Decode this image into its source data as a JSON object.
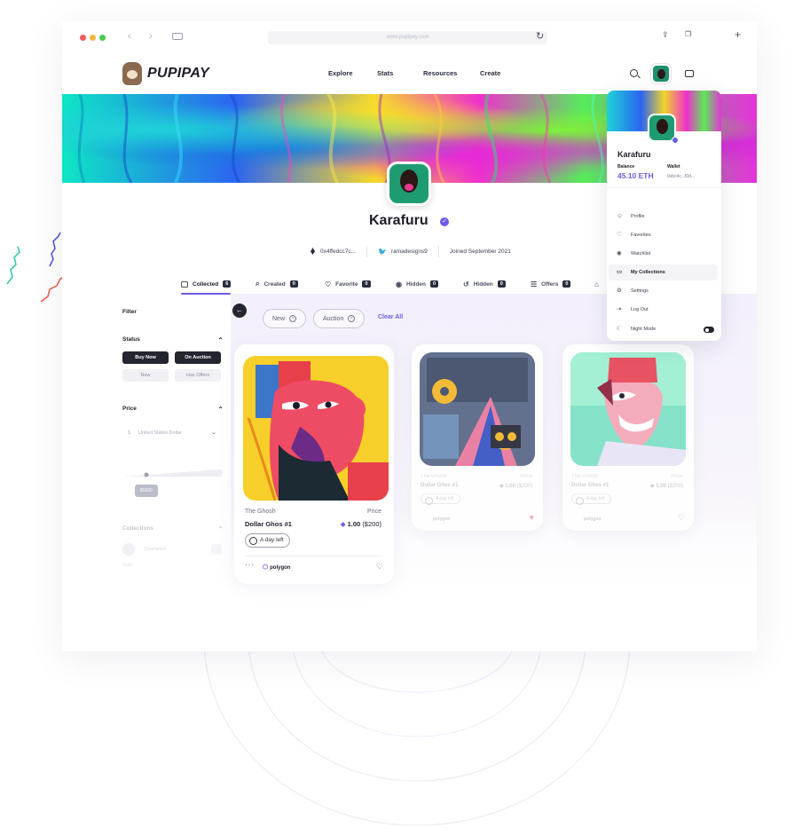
{
  "browser": {
    "url": "www.pupipay.com"
  },
  "site": {
    "brand": "PUPIPAY",
    "nav": [
      "Explore",
      "Stats",
      "Resources",
      "Create"
    ]
  },
  "profile": {
    "name": "Karafuru",
    "address": "0x4ffedcc7c...",
    "twitter": "ramadesigns9",
    "joined": "Joined September 2021"
  },
  "tabs": [
    {
      "label": "Collected",
      "count": "6"
    },
    {
      "label": "Created",
      "count": "0"
    },
    {
      "label": "Favorite",
      "count": "0"
    },
    {
      "label": "Hidden",
      "count": "0"
    },
    {
      "label": "Hidden",
      "count": "0"
    },
    {
      "label": "Offers",
      "count": "0"
    }
  ],
  "filter": {
    "title": "Filter",
    "status": {
      "title": "Status",
      "options": [
        "Buy Now",
        "On Auction",
        "New",
        "Has Offers"
      ]
    },
    "price": {
      "title": "Price",
      "currency": "United States Dollar",
      "badge": "$5000"
    },
    "collections": {
      "title": "Collections",
      "item": "Chameleo",
      "sub": "2066"
    }
  },
  "chips": {
    "items": [
      "New",
      "Auction"
    ],
    "clear_all": "Clear All"
  },
  "cards": [
    {
      "collection": "The Ghosh",
      "price_label": "Price",
      "name": "Dollar Ghos #1",
      "price_eth": "1.00",
      "price_usd": "($200)",
      "time_left": "A day left",
      "chain": "polygon"
    },
    {
      "collection": "The Ghosh",
      "price_label": "Price",
      "name": "Dollar Ghos #1",
      "price_eth": "1.00",
      "price_usd": "($200)",
      "time_left": "A day left",
      "chain": "polygon"
    },
    {
      "collection": "The Ghosh",
      "price_label": "Price",
      "name": "Dollar Ghos #1",
      "price_eth": "1.00",
      "price_usd": "($200)",
      "time_left": "A day left",
      "chain": "polygon"
    }
  ],
  "dropdown": {
    "name": "Karafuru",
    "balance_label": "Balance",
    "balance": "45.10 ETH",
    "wallet_label": "Wallet",
    "wallet": "0xbc4c...f0d...",
    "items": [
      "Profile",
      "Favorites",
      "Watchlist",
      "My Collections",
      "Settings",
      "Log Out",
      "Night Mode"
    ]
  },
  "colors": {
    "accent": "#6c5ce7",
    "dark": "#23252f"
  }
}
